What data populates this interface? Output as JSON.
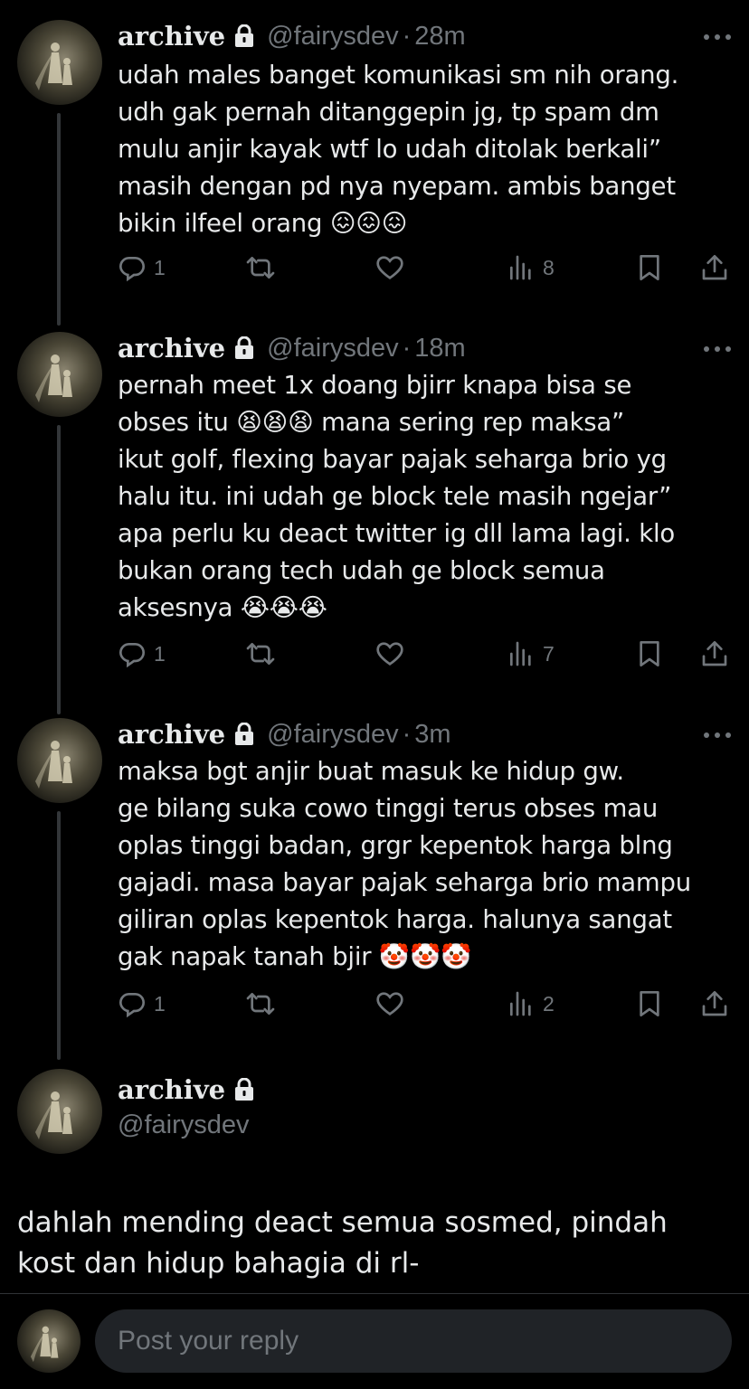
{
  "tweets": [
    {
      "name": "archive",
      "handle": "@fairysdev",
      "sep": "·",
      "time": "28m",
      "text": "udah males banget komunikasi sm nih orang.\nudh gak pernah ditanggepin jg, tp spam dm\nmulu anjir kayak wtf lo udah ditolak berkali”\nmasih dengan pd nya nyepam. ambis banget\nbikin ilfeel orang 😖😖😖",
      "replies": "1",
      "views": "8"
    },
    {
      "name": "archive",
      "handle": "@fairysdev",
      "sep": "·",
      "time": "18m",
      "text": "pernah meet 1x doang bjirr knapa bisa se\nobses itu 😫😫😫 mana sering rep maksa”\nikut golf, flexing bayar pajak seharga brio yg\nhalu itu. ini udah ge block tele masih ngejar”\napa perlu ku deact twitter ig dll lama lagi. klo\nbukan orang tech udah ge block semua\naksesnya 😭😭😭",
      "replies": "1",
      "views": "7"
    },
    {
      "name": "archive",
      "handle": "@fairysdev",
      "sep": "·",
      "time": "3m",
      "text": "maksa bgt anjir buat masuk ke hidup gw.\nge bilang suka cowo tinggi terus obses mau\noplas tinggi badan, grgr kepentok harga blng\ngajadi. masa bayar pajak seharga brio mampu\ngiliran oplas kepentok harga. halunya sangat\ngak napak tanah bjir 🤡🤡🤡",
      "replies": "1",
      "views": "2"
    }
  ],
  "main_tweet": {
    "name": "archive",
    "handle": "@fairysdev",
    "text": "dahlah mending deact semua sosmed, pindah\nkost dan hidup bahagia di rl-"
  },
  "reply": {
    "placeholder": "Post your reply"
  },
  "icons": {
    "reply": "reply-icon",
    "retweet": "retweet-icon",
    "like": "heart-icon",
    "views": "views-icon",
    "bookmark": "bookmark-icon",
    "share": "share-icon",
    "lock": "lock-icon",
    "more": "more-icon"
  },
  "colors": {
    "background": "#000000",
    "text": "#e7e9ea",
    "secondary": "#71767b",
    "input_bg": "#202327"
  }
}
